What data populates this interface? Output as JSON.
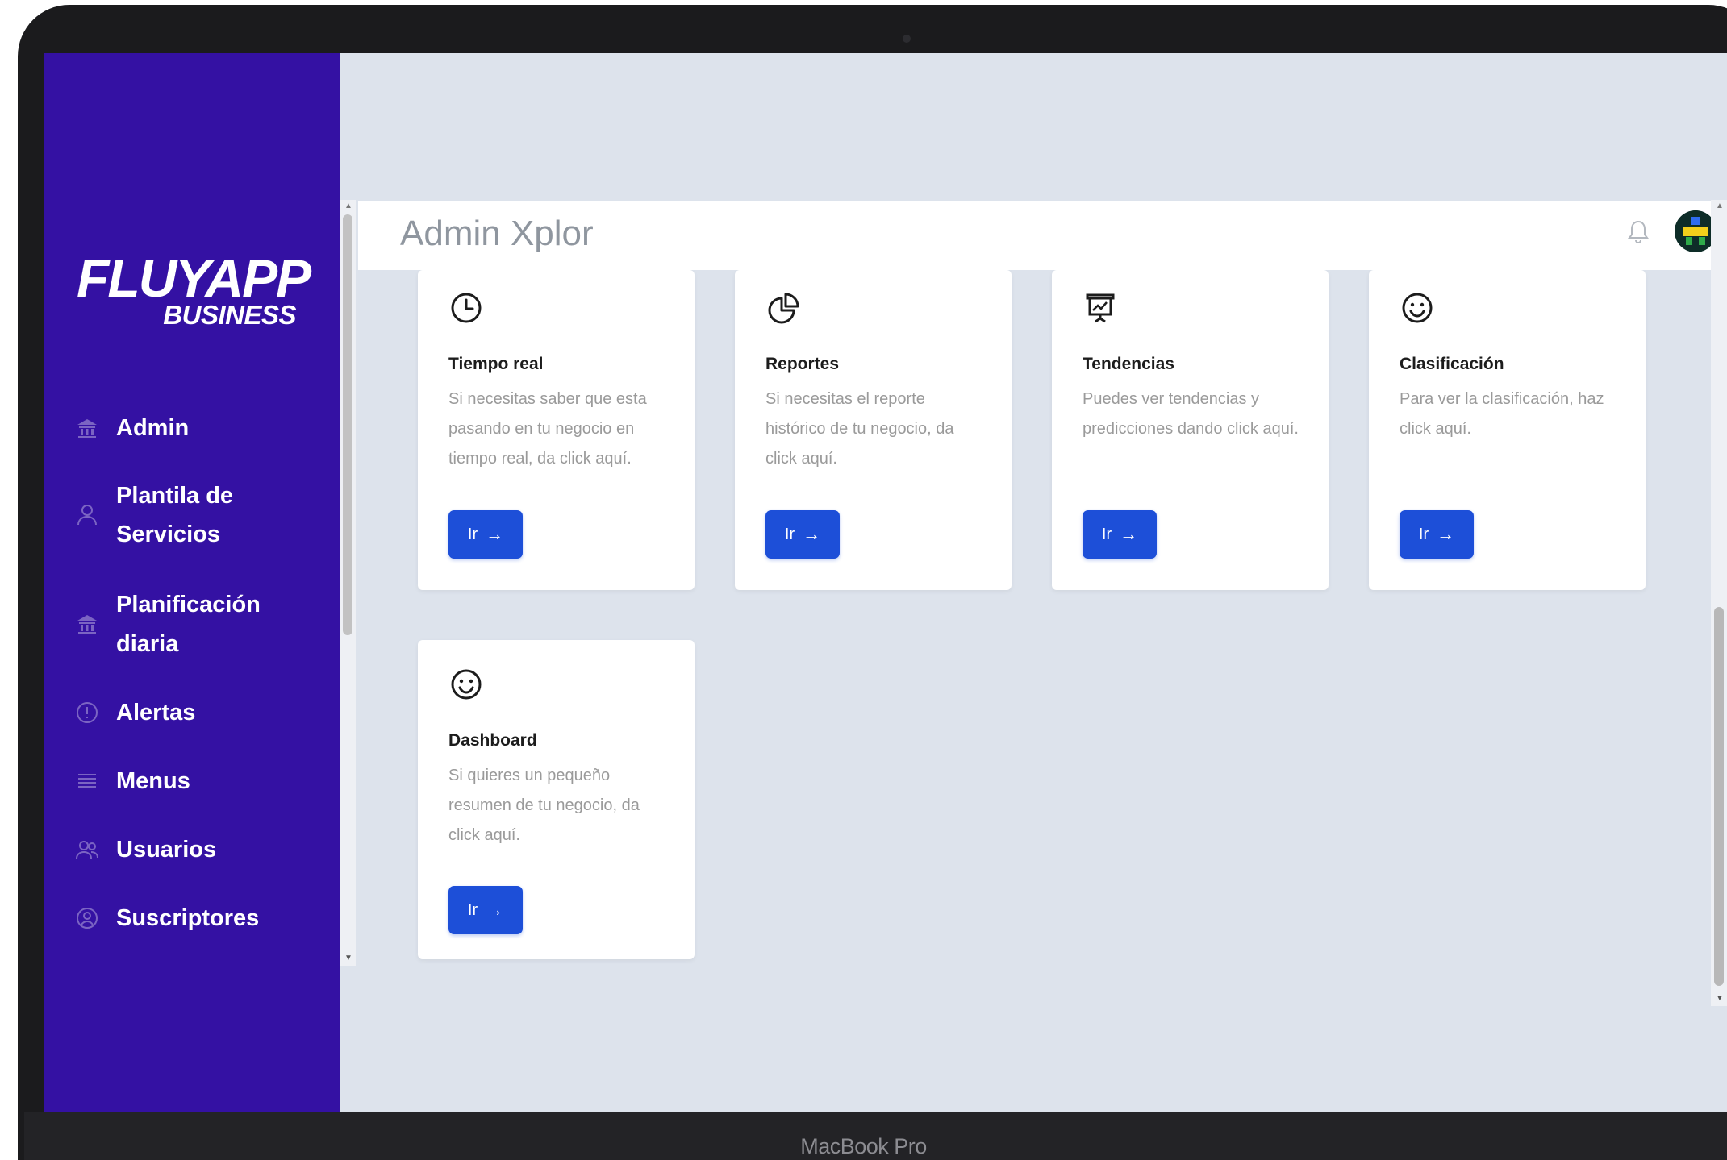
{
  "device": {
    "label": "MacBook Pro"
  },
  "brand": {
    "name_main": "FLUYAPP",
    "name_sub": "BUSINESS"
  },
  "sidebar": {
    "items": [
      {
        "label": "Admin",
        "icon": "bank-icon"
      },
      {
        "label_line1": "Plantila de",
        "label_line2": "Servicios",
        "icon": "user-icon"
      },
      {
        "label_line1": "Planificación",
        "label_line2": "diaria",
        "icon": "bank-icon"
      },
      {
        "label": "Alertas",
        "icon": "alert-circle-icon"
      },
      {
        "label": "Menus",
        "icon": "menu-lines-icon"
      },
      {
        "label": "Usuarios",
        "icon": "users-icon"
      },
      {
        "label": "Suscriptores",
        "icon": "user-circle-icon"
      }
    ]
  },
  "header": {
    "title": "Admin Xplor"
  },
  "cards": [
    {
      "title": "Tiempo real",
      "desc": "Si necesitas saber que esta pasando en tu negocio en tiempo real, da click aquí.",
      "button": "Ir",
      "icon": "clock-icon"
    },
    {
      "title": "Reportes",
      "desc": "Si necesitas el reporte histórico de tu negocio, da click aquí.",
      "button": "Ir",
      "icon": "pie-chart-icon"
    },
    {
      "title": "Tendencias",
      "desc": "Puedes ver tendencias y predicciones dando click aquí.",
      "button": "Ir",
      "icon": "presentation-chart-icon"
    },
    {
      "title": "Clasificación",
      "desc": "Para ver la clasificación, haz click aquí.",
      "button": "Ir",
      "icon": "smile-icon"
    },
    {
      "title": "Dashboard",
      "desc": "Si quieres un pequeño resumen de tu negocio, da click aquí.",
      "button": "Ir",
      "icon": "smile-icon"
    }
  ],
  "colors": {
    "sidebar": "#3411a3",
    "background": "#dde3ec",
    "button": "#1d4fd8",
    "title_gray": "#8f969f"
  }
}
